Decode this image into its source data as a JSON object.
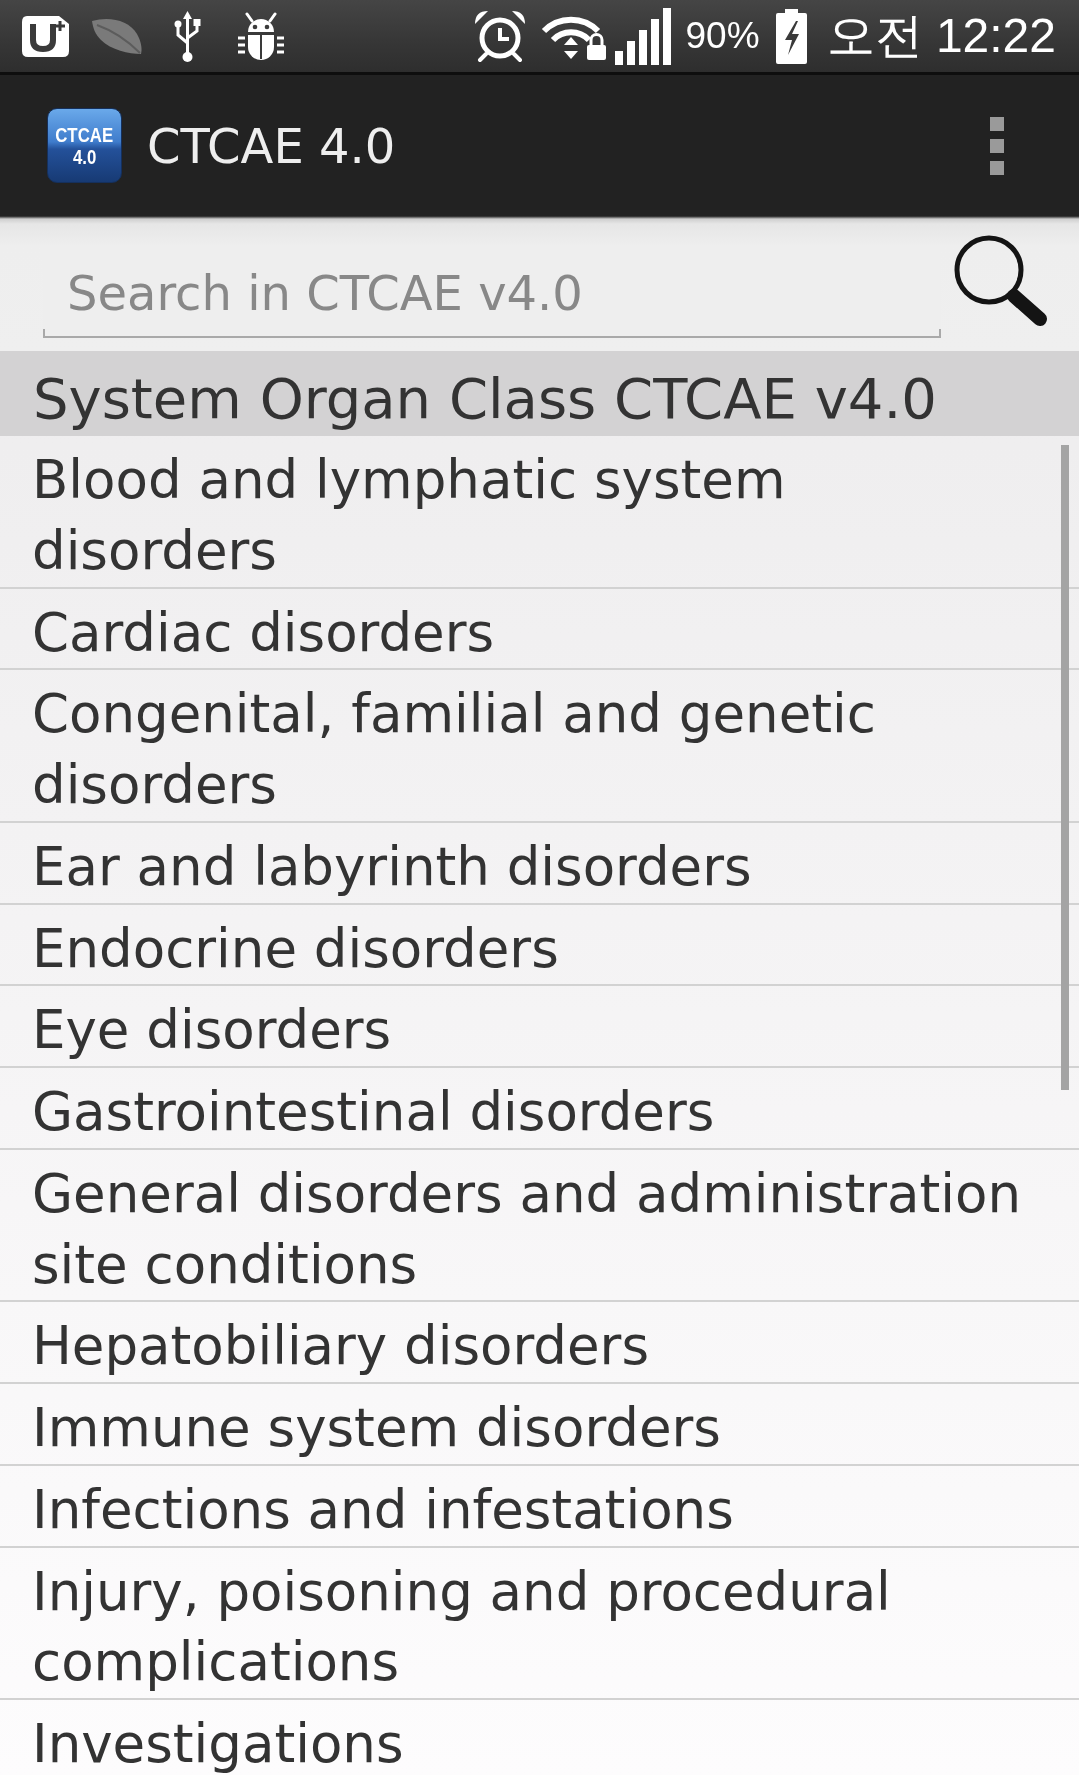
{
  "status_bar": {
    "battery_percent": "90%",
    "time": "오전 12:22"
  },
  "app_bar": {
    "logo_text": [
      "CTCAE",
      "4.0"
    ],
    "title": "CTCAE 4.0"
  },
  "search": {
    "placeholder": "Search in CTCAE v4.0"
  },
  "list": {
    "header": "System Organ Class CTCAE v4.0",
    "items": [
      "Blood and lymphatic system disorders",
      "Cardiac disorders",
      "Congenital, familial and genetic disorders",
      "Ear and labyrinth disorders",
      "Endocrine disorders",
      "Eye disorders",
      "Gastrointestinal disorders",
      "General disorders and administration site conditions",
      "Hepatobiliary disorders",
      "Immune system disorders",
      "Infections and infestations",
      "Injury, poisoning and procedural complications",
      "Investigations"
    ]
  }
}
